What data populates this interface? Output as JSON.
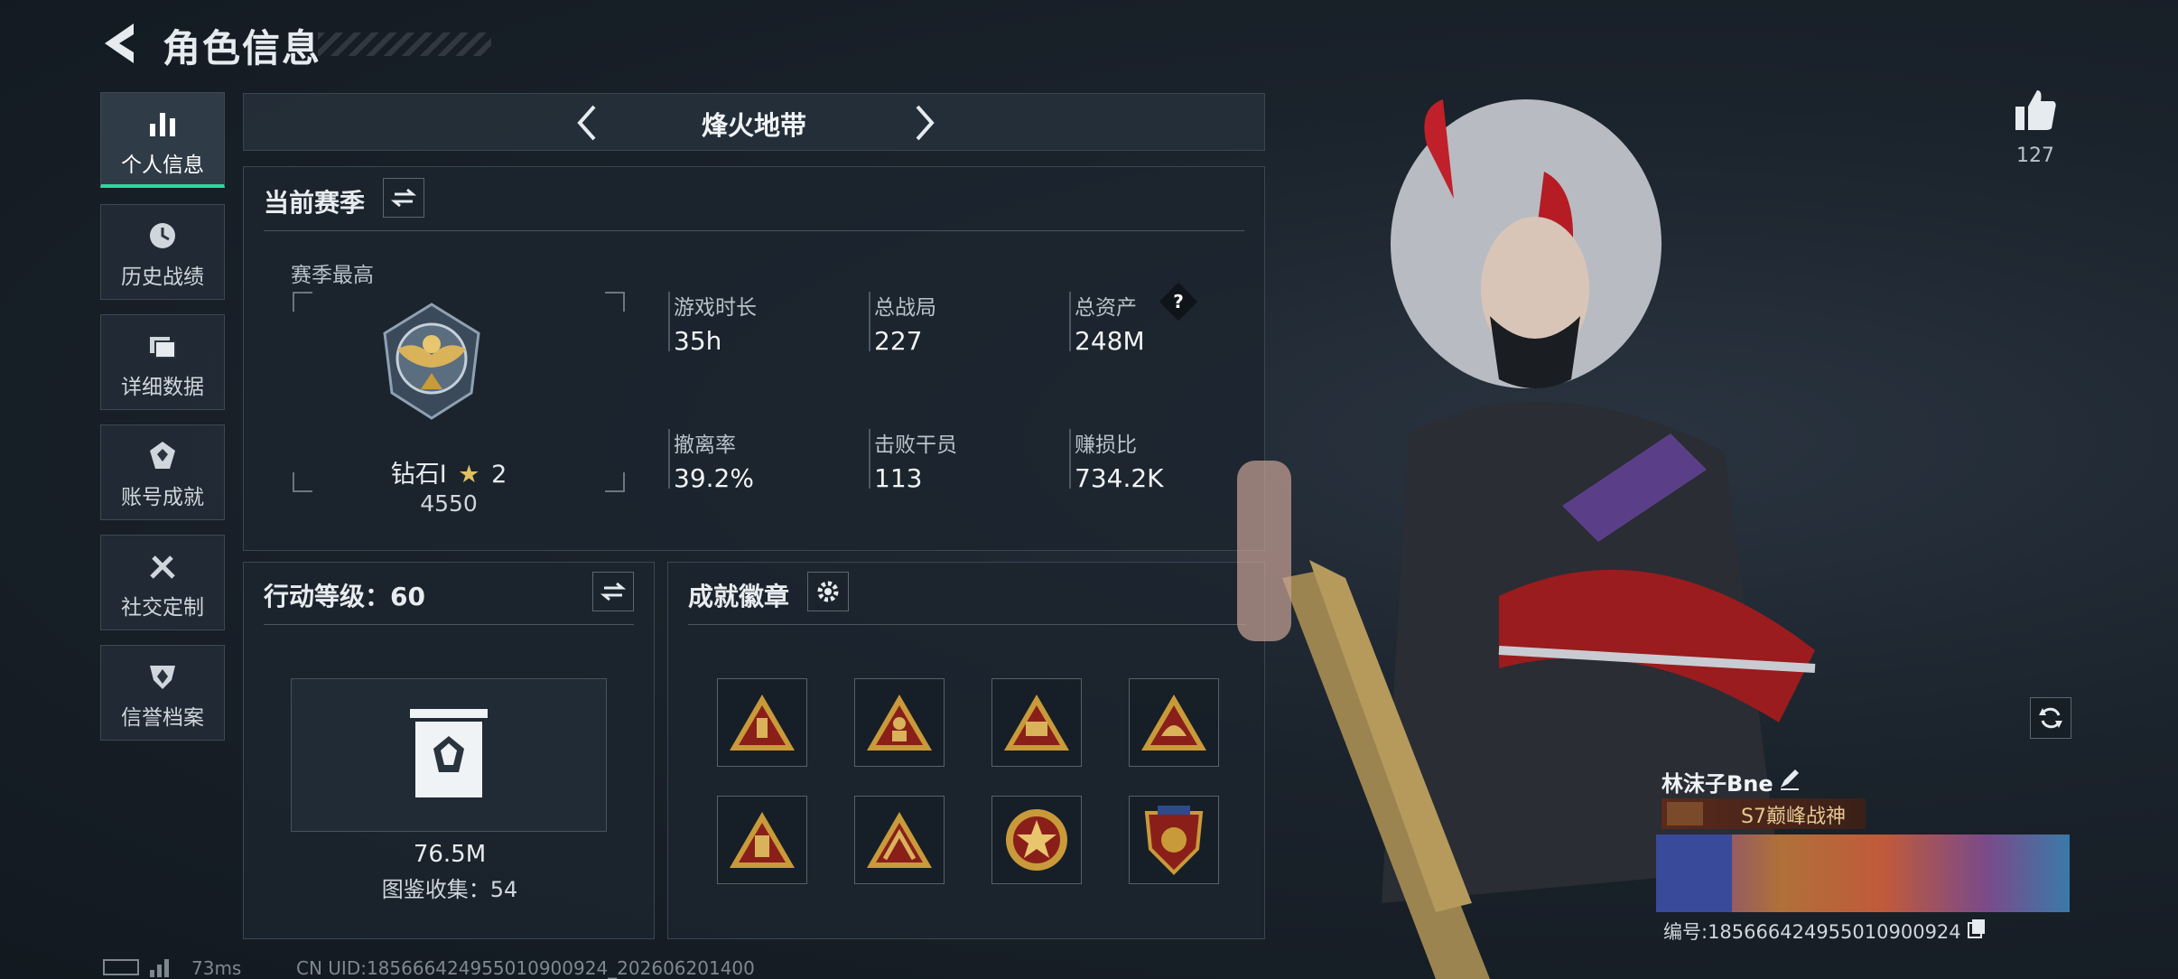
{
  "header": {
    "title": "角色信息"
  },
  "sidebar": {
    "items": [
      {
        "label": "个人信息",
        "icon": "bar-chart-icon",
        "active": true
      },
      {
        "label": "历史战绩",
        "icon": "history-clock-icon"
      },
      {
        "label": "详细数据",
        "icon": "folder-icon"
      },
      {
        "label": "账号成就",
        "icon": "achievement-icon"
      },
      {
        "label": "社交定制",
        "icon": "tools-icon"
      },
      {
        "label": "信誉档案",
        "icon": "shield-icon"
      }
    ]
  },
  "mode_selector": {
    "label": "烽火地带"
  },
  "season": {
    "title": "当前赛季",
    "best_label": "赛季最高",
    "rank_name": "钻石Ⅰ",
    "rank_stars": "2",
    "rank_score": "4550",
    "stats": [
      {
        "label": "游戏时长",
        "value": "35h"
      },
      {
        "label": "总战局",
        "value": "227"
      },
      {
        "label": "总资产",
        "value": "248M",
        "help": "?"
      },
      {
        "label": "撤离率",
        "value": "39.2%"
      },
      {
        "label": "击败干员",
        "value": "113"
      },
      {
        "label": "赚损比",
        "value": "734.2K"
      }
    ]
  },
  "action_level": {
    "title": "行动等级：60",
    "value": "76.5M",
    "collection": "图鉴收集：54"
  },
  "achievements": {
    "title": "成就徽章",
    "badges": [
      "badge-1",
      "badge-2",
      "badge-3",
      "badge-4",
      "badge-5",
      "badge-6",
      "badge-7",
      "badge-8"
    ]
  },
  "profile": {
    "likes": "127",
    "name": "林沫子Bne",
    "title_tag": "S7巅峰战神",
    "id_label": "编号:1856664249550109009​24"
  },
  "footer": {
    "ping": "73ms",
    "uid": "CN UID:185666424955010900924_202606201400"
  },
  "colors": {
    "accent": "#2fd6a0",
    "badge_gold": "#c99a3a",
    "badge_red": "#8a1f1a"
  }
}
